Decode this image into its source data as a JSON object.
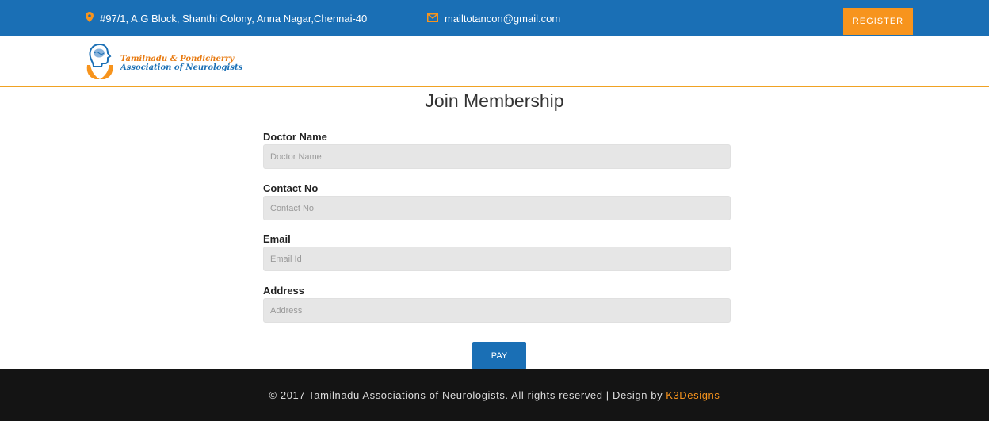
{
  "topbar": {
    "address_icon": "map-pin-icon",
    "address": "#97/1, A.G Block, Shanthi Colony, Anna Nagar,Chennai-40",
    "email_icon": "envelope-icon",
    "email": "mailtotancon@gmail.com",
    "register_label": "REGISTER"
  },
  "logo": {
    "line1": "Tamilnadu & Pondicherry",
    "line2": "Association of Neurologists"
  },
  "page": {
    "title": "Join Membership"
  },
  "form": {
    "doctor_name": {
      "label": "Doctor Name",
      "placeholder": "Doctor Name"
    },
    "contact_no": {
      "label": "Contact No",
      "placeholder": "Contact No"
    },
    "email": {
      "label": "Email",
      "placeholder": "Email Id"
    },
    "address": {
      "label": "Address",
      "placeholder": "Address"
    },
    "pay_label": "PAY"
  },
  "footer": {
    "copyright": "© 2017 Tamilnadu Associations of Neurologists. All rights reserved | Design by",
    "designer": "K3Designs"
  },
  "colors": {
    "topbar": "#1a6fb5",
    "accent": "#f7941d",
    "footer": "#141414"
  }
}
